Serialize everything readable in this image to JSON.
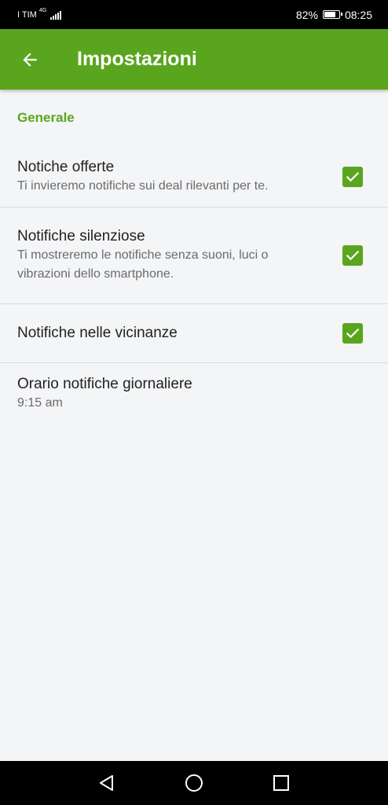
{
  "status_bar": {
    "carrier": "I TIM",
    "network": "4G",
    "battery": "82%",
    "battery_level": 0.82,
    "time": "08:25"
  },
  "app_bar": {
    "title": "Impostazioni",
    "back_icon": "arrow-left-icon"
  },
  "section": {
    "title": "Generale"
  },
  "preferences": [
    {
      "title": "Notiche offerte",
      "summary": "Ti invieremo notifiche sui deal rilevanti per te.",
      "checked": true
    },
    {
      "title": "Notifiche silenziose",
      "summary": "Ti mostreremo le notifiche senza suoni, luci o vibrazioni dello smartphone.",
      "checked": true
    },
    {
      "title": "Notifiche nelle vicinanze",
      "summary": "",
      "checked": true
    },
    {
      "title": "Orario notifiche giornaliere",
      "summary": "9:15 am"
    }
  ],
  "colors": {
    "accent": "#5aa51e",
    "background": "#f4f5f7",
    "divider": "#dadbdd"
  },
  "nav_bar": {
    "back_icon": "triangle-back-icon",
    "home_icon": "circle-home-icon",
    "recents_icon": "square-recents-icon"
  }
}
